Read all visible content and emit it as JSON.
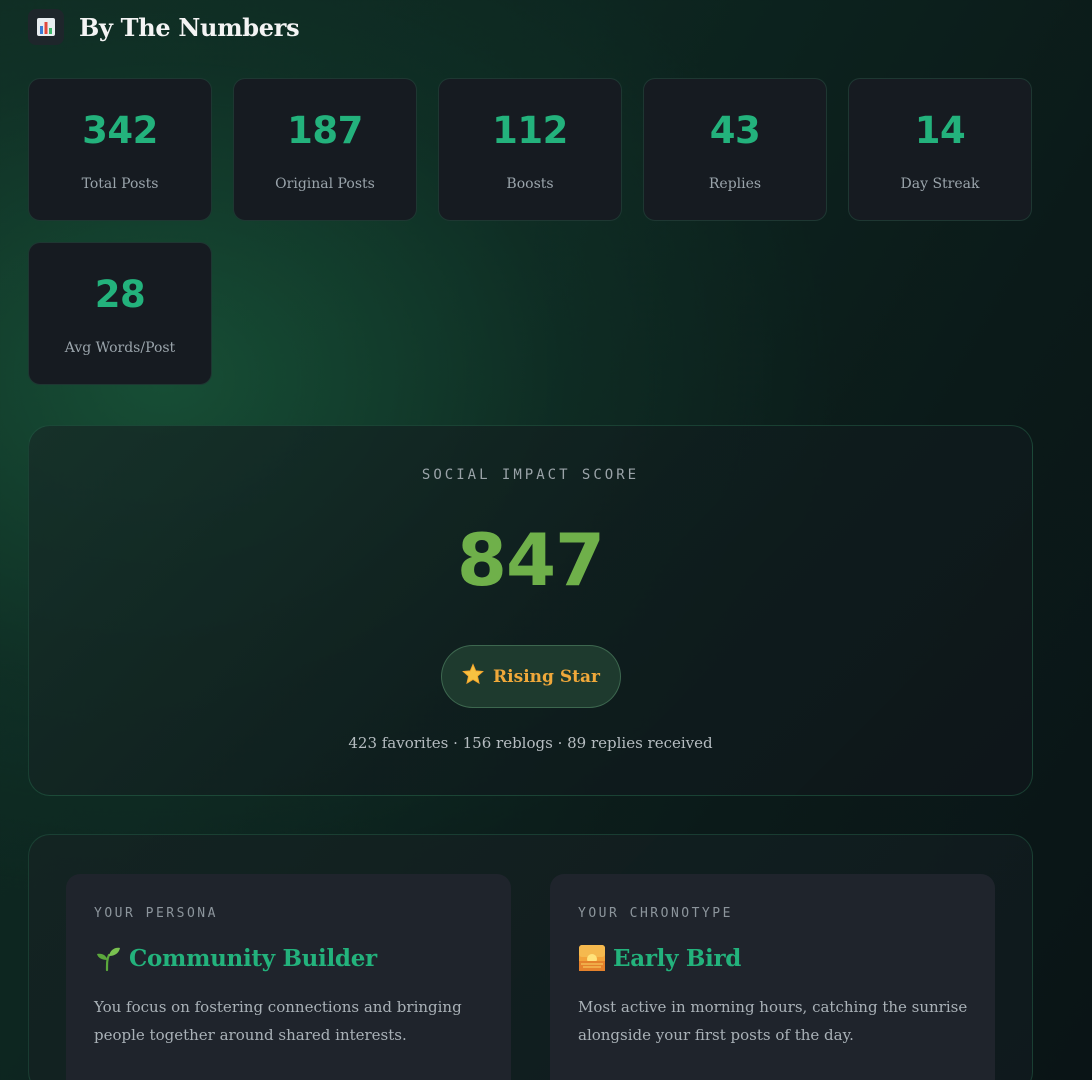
{
  "header": {
    "icon": "bar-chart-icon",
    "title": "By The Numbers"
  },
  "stats": [
    {
      "value": "342",
      "label": "Total Posts"
    },
    {
      "value": "187",
      "label": "Original Posts"
    },
    {
      "value": "112",
      "label": "Boosts"
    },
    {
      "value": "43",
      "label": "Replies"
    },
    {
      "value": "14",
      "label": "Day Streak"
    },
    {
      "value": "28",
      "label": "Avg Words/Post"
    }
  ],
  "impact": {
    "label": "SOCIAL IMPACT SCORE",
    "score": "847",
    "badge": {
      "icon": "star-icon",
      "label": "Rising Star"
    },
    "summary": "423 favorites · 156 reblogs · 89 replies received"
  },
  "persona": {
    "kicker": "YOUR PERSONA",
    "icon": "seedling-icon",
    "title": "Community Builder",
    "description": "You focus on fostering connections and bringing people together around shared interests."
  },
  "chronotype": {
    "kicker": "YOUR CHRONOTYPE",
    "icon": "sunrise-icon",
    "title": "Early Bird",
    "description": "Most active in morning hours, catching the sunrise alongside your first posts of the day."
  },
  "colors": {
    "accent": "#23b27c",
    "score": "#6fb04a",
    "badge": "#f0a83a"
  }
}
